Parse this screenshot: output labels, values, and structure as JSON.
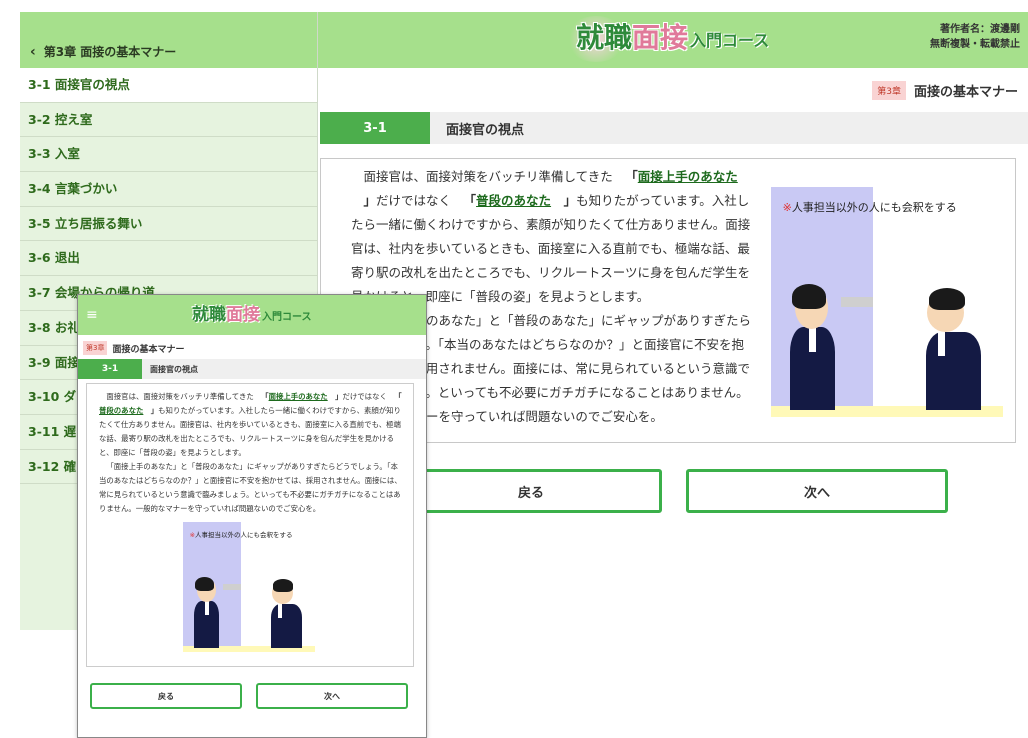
{
  "sidebar": {
    "header": "第3章 面接の基本マナー",
    "items": [
      {
        "label": "3-1 面接官の視点"
      },
      {
        "label": "3-2 控え室"
      },
      {
        "label": "3-3 入室"
      },
      {
        "label": "3-4 言葉づかい"
      },
      {
        "label": "3-5 立ち居振る舞い"
      },
      {
        "label": "3-6 退出"
      },
      {
        "label": "3-7 会場からの帰り道"
      },
      {
        "label": "3-8 お礼"
      },
      {
        "label": "3-9 面接"
      },
      {
        "label": "3-10 ダ"
      },
      {
        "label": "3-11 遅"
      },
      {
        "label": "3-12 確"
      }
    ]
  },
  "header": {
    "logo": {
      "part1": "就職",
      "part2": "面接",
      "part3": "入門コース"
    },
    "author": "著作者名：渡邊剛",
    "notice": "無断複製・転載禁止"
  },
  "chapter": {
    "badge": "第3章",
    "title": "面接の基本マナー"
  },
  "section": {
    "number": "3-1",
    "title": "面接官の視点"
  },
  "content": {
    "p1_a": "面接官は、面接対策をバッチリ準備してきた",
    "link1": "面接上手のあなた",
    "p1_b": "だけではなく",
    "link2": "普段のあなた",
    "p1_c": "も知りたがっています。入社したら一緒に働くわけですから、素顔が知りたくて仕方ありません。面接官は、社内を歩いているときも、面接室に入る直前でも、極端な話、最寄り駅の改札を出たところでも、リクルートスーツに身を包んだ学生を見かけると、即座に「普段の姿」を見ようとします。",
    "p2": "「面接上手のあなた」と「普段のあなた」にギャップがありすぎたらどうでしょう。「本当のあなたはどちらなのか？」と面接官に不安を抱かせては、採用されません。面接には、常に見られているという意識で臨みましょう。といっても不必要にガチガチになることはありません。一般的なマナーを守っていれば問題ないのでご安心を。",
    "caption_mark": "※",
    "caption": "人事担当以外の人にも会釈をする"
  },
  "nav": {
    "back": "戻る",
    "next": "次へ"
  },
  "mobile": {
    "menu_icon": "≡"
  }
}
